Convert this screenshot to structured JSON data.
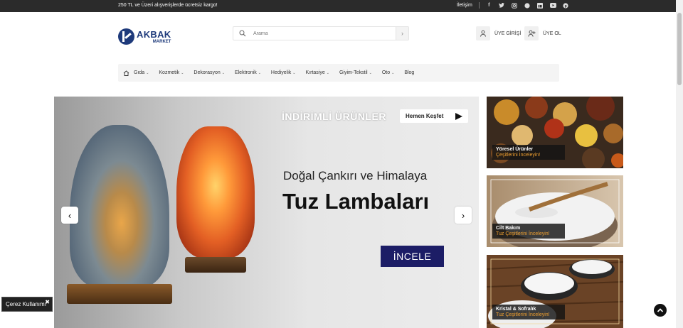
{
  "topbar": {
    "promo": "250 TL ve Üzeri alışverişlerde ücretsiz kargo!",
    "contact_label": "İletişim",
    "social_icons": [
      "facebook-icon",
      "twitter-icon",
      "instagram-icon",
      "whatsapp-icon",
      "linkedin-icon",
      "youtube-icon",
      "pinterest-icon"
    ]
  },
  "brand": {
    "name": "AKBAK",
    "sub": "MARKET",
    "color": "#1e3a7b"
  },
  "search": {
    "placeholder": "Arama"
  },
  "account": {
    "login_label": "ÜYE GİRİŞİ",
    "register_label": "ÜYE OL"
  },
  "nav": {
    "items": [
      {
        "label": "Gıda",
        "has_dropdown": true
      },
      {
        "label": "Kozmetik",
        "has_dropdown": true
      },
      {
        "label": "Dekorasyon",
        "has_dropdown": true
      },
      {
        "label": "Elektronik",
        "has_dropdown": true
      },
      {
        "label": "Hediyelik",
        "has_dropdown": true
      },
      {
        "label": "Kırtasiye",
        "has_dropdown": true
      },
      {
        "label": "Giyim-Tekstil",
        "has_dropdown": true
      },
      {
        "label": "Oto",
        "has_dropdown": true
      },
      {
        "label": "Blog",
        "has_dropdown": false
      }
    ]
  },
  "slider": {
    "headline": "İNDİRİMLİ ÜRÜNLER",
    "discover_button": "Hemen Keşfet",
    "subtitle": "Doğal Çankırı ve Himalaya",
    "title": "Tuz Lambaları",
    "cta": "İNCELE",
    "cta_color": "#1c1d66"
  },
  "cards": [
    {
      "title": "Yöresel Ürünler",
      "subtitle": "Çeşitlerini İnceleyin!"
    },
    {
      "title": "Cilt Bakım",
      "subtitle": "Tuz Çeşitlerini İnceleyin!"
    },
    {
      "title": "Kristal & Sofralık",
      "subtitle": "Tuz Çeşitlerini İnceleyin!"
    }
  ],
  "cookie": {
    "label": "Çerez Kullanımı"
  },
  "accent_color": "#f0a030"
}
